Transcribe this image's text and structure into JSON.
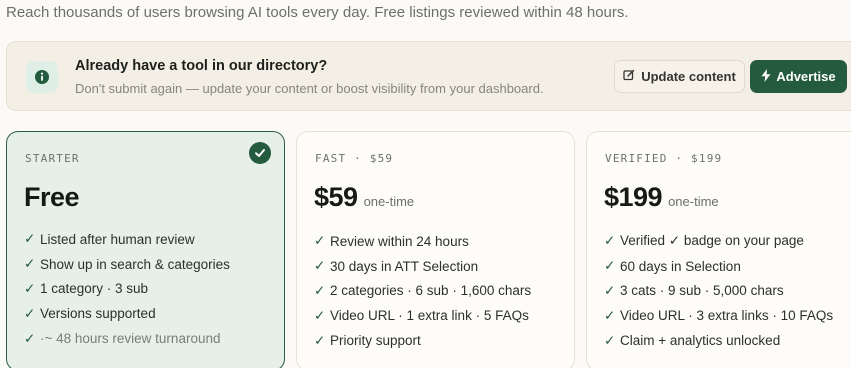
{
  "header": {
    "subtitle": "Reach thousands of users browsing AI tools every day. Free listings reviewed within 48 hours."
  },
  "banner": {
    "icon": "info-icon",
    "title": "Already have a tool in our directory?",
    "description": "Don't submit again — update your content or boost visibility from your dashboard.",
    "update_button": {
      "icon": "edit-icon",
      "label": "Update content"
    },
    "advertise_button": {
      "icon": "lightning-icon",
      "label": "Advertise"
    }
  },
  "plans": [
    {
      "eyebrow": "STARTER",
      "price": "Free",
      "price_suffix": "",
      "selected": true,
      "features": [
        "Listed after human review",
        "Show up in search & categories",
        "1 category · 3 sub",
        "Versions supported",
        "·~ 48 hours review turnaround"
      ]
    },
    {
      "eyebrow": "FAST · $59",
      "price": "$59",
      "price_suffix": "one-time",
      "selected": false,
      "features": [
        "Review within 24 hours",
        "30 days in ATT Selection",
        "2 categories · 6 sub · 1,600 chars",
        "Video URL · 1 extra link · 5 FAQs",
        "Priority support"
      ]
    },
    {
      "eyebrow": "VERIFIED · $199",
      "price": "$199",
      "price_suffix": "one-time",
      "selected": false,
      "features": [
        "Verified ✓ badge on your page",
        "60 days in Selection",
        "3 cats · 9 sub · 5,000 chars",
        "Video URL · 3 extra links · 10 FAQs",
        "Claim + analytics unlocked"
      ]
    }
  ],
  "colors": {
    "accent": "#245a3d",
    "selected_card_bg": "#e6efe8",
    "banner_bg": "#f3efe5"
  }
}
